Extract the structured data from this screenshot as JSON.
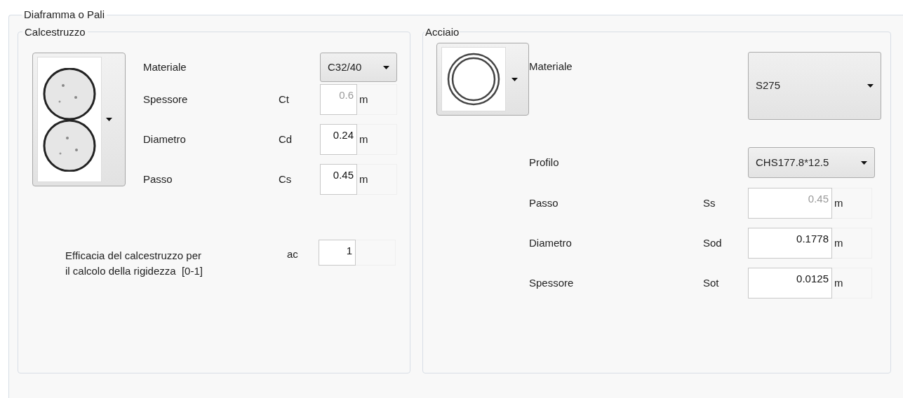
{
  "group_title": "Diaframma o Pali",
  "concrete": {
    "title": "Calcestruzzo",
    "material": {
      "label": "Materiale",
      "value": "C32/40"
    },
    "fields": [
      {
        "label": "Spessore",
        "symbol": "Ct",
        "value": "0.6",
        "unit": "m",
        "disabled": true
      },
      {
        "label": "Diametro",
        "symbol": "Cd",
        "value": "0.24",
        "unit": "m",
        "disabled": false
      },
      {
        "label": "Passo",
        "symbol": "Cs",
        "value": "0.45",
        "unit": "m",
        "disabled": false
      }
    ],
    "efficacy": {
      "label": "Efficacia del calcestruzzo per il calcolo della rigidezza  [0-1]",
      "symbol": "ac",
      "value": "1",
      "disabled": false
    }
  },
  "steel": {
    "title": "Acciaio",
    "material": {
      "label": "Materiale",
      "value": "S275"
    },
    "profile": {
      "label": "Profilo",
      "value": "CHS177.8*12.5"
    },
    "fields": [
      {
        "label": "Passo",
        "symbol": "Ss",
        "value": "0.45",
        "unit": "m",
        "disabled": true
      },
      {
        "label": "Diametro",
        "symbol": "Sod",
        "value": "0.1778",
        "unit": "m",
        "disabled": false
      },
      {
        "label": "Spessore",
        "symbol": "Sot",
        "value": "0.0125",
        "unit": "m",
        "disabled": false
      }
    ]
  }
}
